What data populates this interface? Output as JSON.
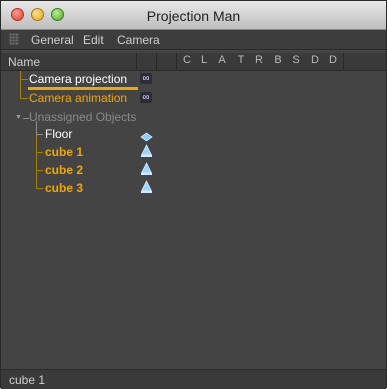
{
  "window": {
    "title": "Projection Man"
  },
  "menu": {
    "items": [
      "General",
      "Edit",
      "Camera"
    ]
  },
  "header": {
    "name_label": "Name",
    "columns": [
      "C",
      "L",
      "A",
      "T",
      "R",
      "B",
      "S",
      "D",
      "D"
    ]
  },
  "tree": {
    "camera_projection": {
      "label": "Camera  projection",
      "tag_icon": "infinity-tag-icon"
    },
    "camera_animation": {
      "label": "Camera  animation",
      "tag_icon": "infinity-tag-icon"
    },
    "unassigned": {
      "label": "Unassigned Objects"
    },
    "floor": {
      "label": "Floor",
      "tag_icon": "plane-tag-icon"
    },
    "cube1": {
      "label": "cube 1",
      "tag_icon": "projection-tag-icon"
    },
    "cube2": {
      "label": "cube 2",
      "tag_icon": "projection-tag-icon"
    },
    "cube3": {
      "label": "cube 3",
      "tag_icon": "projection-tag-icon"
    }
  },
  "status": {
    "text": "cube 1"
  },
  "colors": {
    "accent": "#f0a800",
    "background": "#444444"
  }
}
